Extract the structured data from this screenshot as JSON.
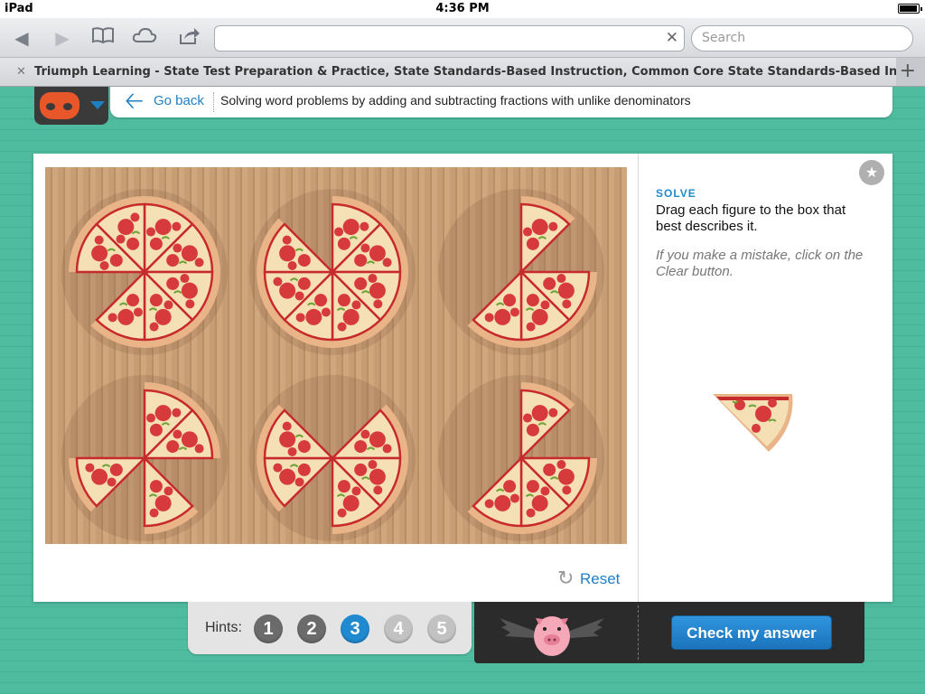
{
  "status_bar": {
    "carrier": "iPad",
    "time": "4:36 PM"
  },
  "browser": {
    "search_placeholder": "Search",
    "url_value": "",
    "tab_title": "Triumph Learning - State Test Preparation & Practice, State Standards-Based Instruction, Common Core State Standards-Based Instruction, Blended..."
  },
  "header": {
    "go_back": "Go back",
    "title": "Solving word problems by adding and subtracting fractions with unlike denominators"
  },
  "activity": {
    "solve_heading": "SOLVE",
    "instruction": "Drag each figure to the box that best describes it.",
    "note": "If you make a mistake, click on the Clear button.",
    "reset_label": "Reset",
    "pizzas": [
      {
        "slices": 8,
        "shown": 7
      },
      {
        "slices": 8,
        "shown": 7
      },
      {
        "slices": 8,
        "shown": 4
      },
      {
        "slices": 8,
        "shown": 4
      },
      {
        "slices": 8,
        "shown": 5
      },
      {
        "slices": 8,
        "shown": 4
      }
    ]
  },
  "footer": {
    "hints_label": "Hints:",
    "hints": [
      "1",
      "2",
      "3",
      "4",
      "5"
    ],
    "active_hint": "3",
    "check_label": "Check my answer"
  },
  "colors": {
    "accent": "#1f7fc4",
    "background": "#4bb89c",
    "brand_orange": "#e8572a"
  }
}
